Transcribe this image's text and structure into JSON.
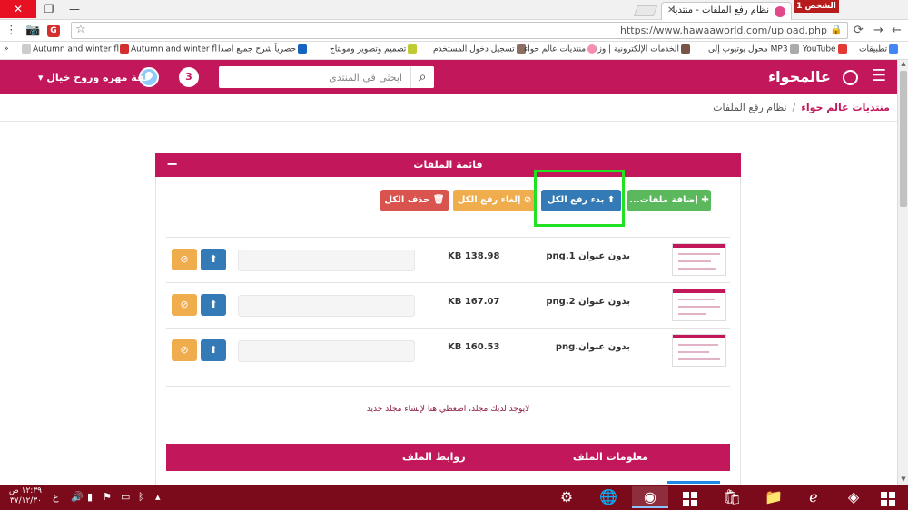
{
  "browser": {
    "tab_title": "نظام رفع الملفات - منتديا",
    "profile_badge": "الشخص 1",
    "url": "https://www.hawaaworld.com/upload.php",
    "bookmarks": [
      "تطبيقات",
      "YouTube",
      "محول يوتيوب إلى MP3",
      "الخدمات الإلكترونية | وزا",
      "منتديات عالم حواء",
      "تسجيل دخول المستخدم",
      "تصميم وتصوير ومونتاج",
      "حصرياً شرح جميع اصدا",
      "Autumn and winter fl",
      "Autumn and winter fl"
    ],
    "more": "»"
  },
  "header": {
    "logo": "عالمحواء",
    "search_placeholder": "ابحثي في المنتدى",
    "notifications": "3",
    "user_name": "عفة مهره وروح خيال"
  },
  "breadcrumb": {
    "home": "منتديات عالم حواء",
    "separator": "/",
    "current": "نظام رفع الملفات"
  },
  "panel": {
    "title": "قائمة الملفات",
    "toggle": "−",
    "buttons": {
      "add": "✚ إضافة ملفات...",
      "start": "⬆ بدء رفع الكل",
      "cancel": "⊘ إلغاء رفع الكل",
      "delete": "🗑 حذف الكل"
    },
    "files": [
      {
        "name": "بدون عنوان 1.png",
        "size": "KB 138.98"
      },
      {
        "name": "بدون عنوان 2.png",
        "size": "KB 167.07"
      },
      {
        "name": "بدون عنوان.png",
        "size": "KB 160.53"
      }
    ],
    "folder_message": "لايوجد لديك مجلد، اضغطي هنا لإنشاء مجلد جديد",
    "table_headers": {
      "info": "معلومات الملف",
      "links": "روابط الملف"
    }
  },
  "taskbar": {
    "time": "١٢:٣٩ ص",
    "date": "٣٧/١٢/٣٠",
    "lang": "ع"
  },
  "colors": {
    "brand": "#c2185b",
    "highlight": "#22e022"
  }
}
